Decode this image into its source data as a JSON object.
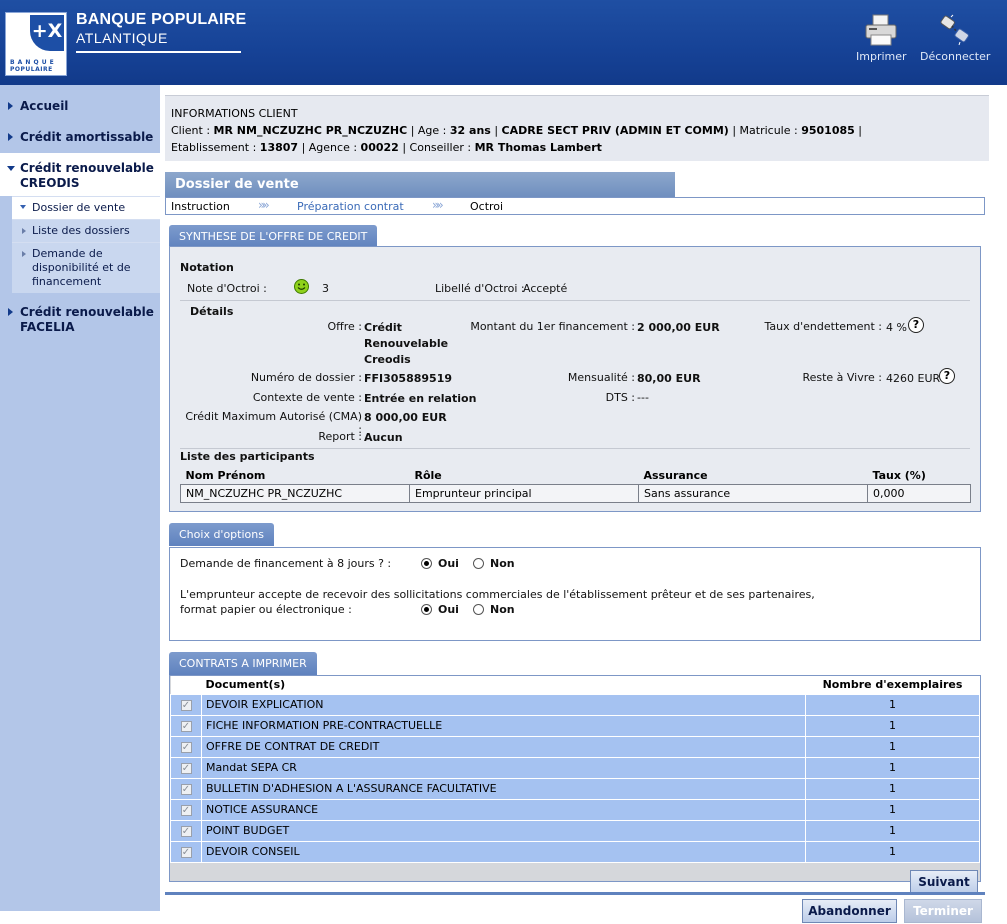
{
  "header": {
    "logo_text": "BANQUE POPULAIRE",
    "logo_mark": "+X",
    "bank_name": "BANQUE POPULAIRE",
    "bank_region": "ATLANTIQUE",
    "print_label": "Imprimer",
    "logout_label": "Déconnecter"
  },
  "sidebar": {
    "items": [
      {
        "label": "Accueil"
      },
      {
        "label": "Crédit amortissable"
      },
      {
        "label": "Crédit renouvelable CREODIS"
      },
      {
        "label": "Crédit renouvelable FACELIA"
      }
    ],
    "subitems": [
      {
        "label": "Dossier de vente"
      },
      {
        "label": "Liste des dossiers"
      },
      {
        "label": "Demande de disponibilité et de financement"
      }
    ]
  },
  "client": {
    "title": "INFORMATIONS CLIENT",
    "client_label": "Client : ",
    "client_name": "MR NM_NCZUZHC PR_NCZUZHC",
    "age_label": " | Age : ",
    "age": "32 ans",
    "profession": "CADRE SECT PRIV (ADMIN ET COMM)",
    "matricule_label": " | Matricule : ",
    "matricule": "9501085",
    "etab_label": "Etablissement : ",
    "etablissement": "13807",
    "agence_label": " | Agence : ",
    "agence": "00022",
    "conseiller_label": " | Conseiller : ",
    "conseiller": "MR Thomas Lambert"
  },
  "dossier": {
    "title": "Dossier de vente",
    "steps": [
      "Instruction",
      "Préparation contrat",
      "Octroi"
    ]
  },
  "synthese": {
    "tab": "SYNTHESE DE L'OFFRE DE CREDIT",
    "notation_title": "Notation",
    "note_label": "Note d'Octroi :",
    "note_value": "3",
    "libelle_label": "Libellé d'Octroi :",
    "libelle_value": "Accepté",
    "details_title": "Détails",
    "offre_label": "Offre :",
    "offre_value": "Crédit Renouvelable Creodis",
    "numero_label": "Numéro de dossier :",
    "numero_value": "FFI305889519",
    "contexte_label": "Contexte de vente :",
    "contexte_value": "Entrée en relation",
    "cma_label": "Crédit Maximum Autorisé (CMA) :",
    "cma_value": "8 000,00 EUR",
    "report_label": "Report :",
    "report_value": "Aucun",
    "montant_label": "Montant du 1er financement :",
    "montant_value": "2 000,00 EUR",
    "mensualite_label": "Mensualité :",
    "mensualite_value": "80,00 EUR",
    "dts_label": "DTS :",
    "dts_value": "---",
    "taux_endet_label": "Taux d'endettement :",
    "taux_endet_value": "4 %",
    "reste_label": "Reste à Vivre :",
    "reste_value": "4260 EUR",
    "participants_title": "Liste des participants",
    "participants_headers": [
      "Nom Prénom",
      "Rôle",
      "Assurance",
      "Taux (%)"
    ],
    "participants": [
      [
        "NM_NCZUZHC PR_NCZUZHC",
        "Emprunteur principal",
        "Sans assurance",
        "0,000"
      ]
    ]
  },
  "options": {
    "tab": "Choix d'options",
    "q1": "Demande de financement à 8 jours ? :",
    "q2_line1": "L'emprunteur accepte de recevoir des sollicitations commerciales de l'établissement prêteur et de ses partenaires,",
    "q2_line2": "format papier ou électronique :",
    "oui": "Oui",
    "non": "Non",
    "q1_selected": "Oui",
    "q2_selected": "Oui"
  },
  "contracts": {
    "tab": "CONTRATS A IMPRIMER",
    "headers": [
      "Document(s)",
      "Nombre d'exemplaires"
    ],
    "rows": [
      {
        "doc": "DEVOIR EXPLICATION",
        "count": "1",
        "checked": true
      },
      {
        "doc": "FICHE INFORMATION PRE-CONTRACTUELLE",
        "count": "1",
        "checked": true
      },
      {
        "doc": "OFFRE DE CONTRAT DE CREDIT",
        "count": "1",
        "checked": true
      },
      {
        "doc": "Mandat SEPA CR",
        "count": "1",
        "checked": true
      },
      {
        "doc": "BULLETIN D'ADHESION A L'ASSURANCE FACULTATIVE",
        "count": "1",
        "checked": true
      },
      {
        "doc": "NOTICE ASSURANCE",
        "count": "1",
        "checked": true
      },
      {
        "doc": "POINT BUDGET",
        "count": "1",
        "checked": true
      },
      {
        "doc": "DEVOIR CONSEIL",
        "count": "1",
        "checked": true
      }
    ]
  },
  "buttons": {
    "suivant": "Suivant",
    "abandonner": "Abandonner",
    "terminer": "Terminer"
  }
}
